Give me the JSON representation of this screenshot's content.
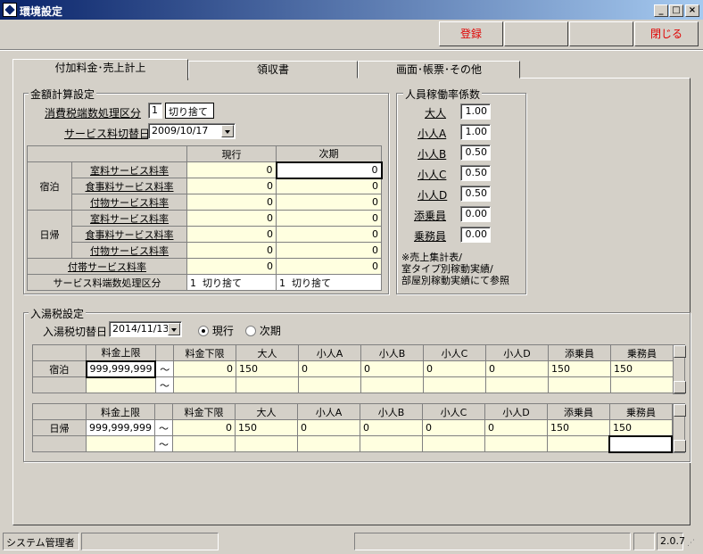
{
  "window": {
    "title": "環境設定"
  },
  "toolbar": {
    "register_label": "登録",
    "close_label": "閉じる"
  },
  "tabs": [
    {
      "label": "付加料金･売上計上"
    },
    {
      "label": "領収書"
    },
    {
      "label": "画面･帳票･その他"
    }
  ],
  "kingaku": {
    "title": "金額計算設定",
    "tax_label": "消費税端数処理区分",
    "tax_code": "1",
    "tax_text": "切り捨て",
    "svc_date_label": "サービス料切替日",
    "svc_date": "2009/10/17",
    "grid": {
      "col_current": "現行",
      "col_next": "次期",
      "rows": [
        {
          "group": "宿泊",
          "label": "室料サービス料率",
          "current": "0",
          "next": "0"
        },
        {
          "label": "食事料サービス料率",
          "current": "0",
          "next": "0"
        },
        {
          "label": "付物サービス料率",
          "current": "0",
          "next": "0"
        },
        {
          "group": "日帰",
          "label": "室料サービス料率",
          "current": "0",
          "next": "0"
        },
        {
          "label": "食事料サービス料率",
          "current": "0",
          "next": "0"
        },
        {
          "label": "付物サービス料率",
          "current": "0",
          "next": "0"
        }
      ],
      "futai_label": "付帯サービス料率",
      "futai_current": "0",
      "futai_next": "0",
      "hasu_label": "サービス料端数処理区分",
      "hasu_current_code": "1",
      "hasu_current_text": "切り捨て",
      "hasu_next_code": "1",
      "hasu_next_text": "切り捨て"
    }
  },
  "jinin": {
    "title": "人員稼働率係数",
    "items": [
      {
        "label": "大人",
        "value": "1.00"
      },
      {
        "label": "小人A",
        "value": "1.00"
      },
      {
        "label": "小人B",
        "value": "0.50"
      },
      {
        "label": "小人C",
        "value": "0.50"
      },
      {
        "label": "小人D",
        "value": "0.50"
      },
      {
        "label": "添乗員",
        "value": "0.00"
      },
      {
        "label": "乗務員",
        "value": "0.00"
      }
    ],
    "note1": "※売上集計表/",
    "note2": "室タイプ別稼動実績/",
    "note3": "部屋別稼動実績にて参照"
  },
  "nyuto": {
    "title": "入湯税設定",
    "date_label": "入湯税切替日",
    "date": "2014/11/13",
    "radio_current": "現行",
    "radio_next": "次期",
    "headers": [
      "料金上限",
      "料金下限",
      "大人",
      "小人A",
      "小人B",
      "小人C",
      "小人D",
      "添乗員",
      "乗務員"
    ],
    "tilde": "～",
    "shukuhaku": {
      "label": "宿泊",
      "values": [
        "999,999,999",
        "0",
        "150",
        "0",
        "0",
        "0",
        "0",
        "150",
        "150"
      ]
    },
    "higaeri": {
      "label": "日帰",
      "values": [
        "999,999,999",
        "0",
        "150",
        "0",
        "0",
        "0",
        "0",
        "150",
        "150"
      ]
    }
  },
  "status": {
    "user": "システム管理者",
    "version": "2.0.7"
  }
}
